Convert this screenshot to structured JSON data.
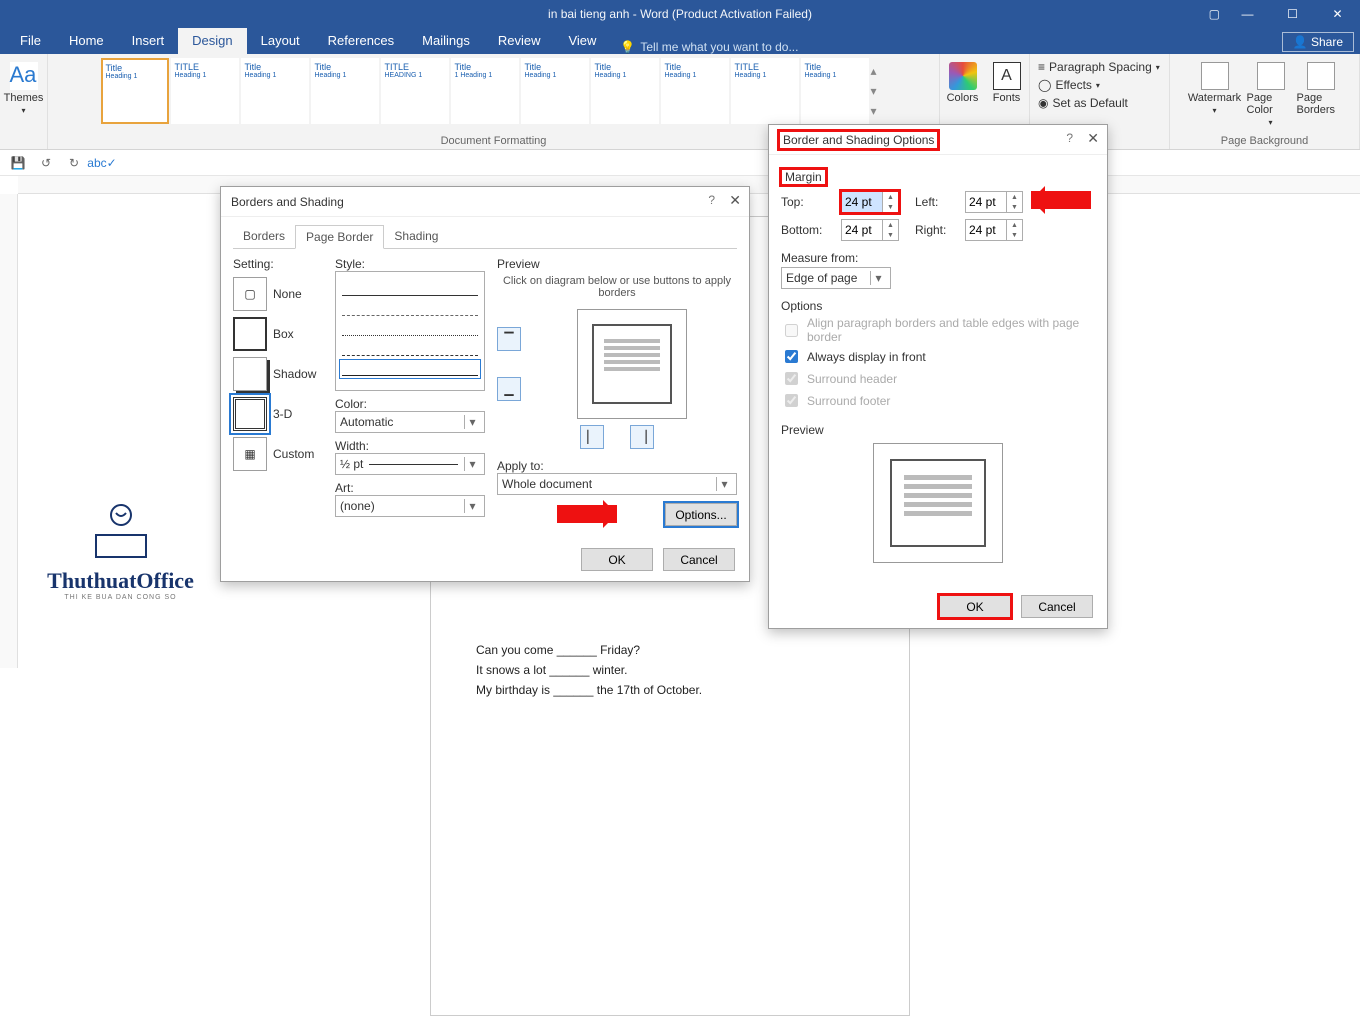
{
  "window": {
    "title": "in bai tieng anh - Word (Product Activation Failed)"
  },
  "ribbon": {
    "tabs": [
      "File",
      "Home",
      "Insert",
      "Design",
      "Layout",
      "References",
      "Mailings",
      "Review",
      "View"
    ],
    "active_tab": "Design",
    "tell_me": "Tell me what you want to do...",
    "share": "Share",
    "doc_formatting_label": "Document Formatting",
    "themes_label": "Themes",
    "colors_label": "Colors",
    "fonts_label": "Fonts",
    "paragraph_spacing": "Paragraph Spacing",
    "effects": "Effects",
    "set_as_default": "Set as Default",
    "page_background_label": "Page Background",
    "watermark": "Watermark",
    "page_color": "Page Color",
    "page_borders": "Page Borders",
    "gallery": [
      "Title",
      "TITLE",
      "Title",
      "Title",
      "TITLE",
      "Title",
      "Title",
      "Title",
      "Title",
      "TITLE",
      "Title"
    ]
  },
  "document": {
    "line1": "Can you come ______ Friday?",
    "line2": "It snows a lot ______ winter.",
    "line3": "My birthday is ______ the 17th of October."
  },
  "dlg_bs": {
    "title": "Borders and Shading",
    "tabs": [
      "Borders",
      "Page Border",
      "Shading"
    ],
    "active_tab": "Page Border",
    "setting_label": "Setting:",
    "settings": {
      "none": "None",
      "box": "Box",
      "shadow": "Shadow",
      "threed": "3-D",
      "custom": "Custom"
    },
    "style_label": "Style:",
    "color_label": "Color:",
    "color_value": "Automatic",
    "width_label": "Width:",
    "width_value": "½ pt",
    "art_label": "Art:",
    "art_value": "(none)",
    "preview_label": "Preview",
    "preview_hint": "Click on diagram below or use buttons to apply borders",
    "apply_to_label": "Apply to:",
    "apply_to_value": "Whole document",
    "options": "Options...",
    "ok": "OK",
    "cancel": "Cancel"
  },
  "dlg_bso": {
    "title": "Border and Shading Options",
    "margin_label": "Margin",
    "top_label": "Top:",
    "bottom_label": "Bottom:",
    "left_label": "Left:",
    "right_label": "Right:",
    "top_value": "24 pt",
    "bottom_value": "24 pt",
    "left_value": "24 pt",
    "right_value": "24 pt",
    "measure_from_label": "Measure from:",
    "measure_from_value": "Edge of page",
    "options_label": "Options",
    "align_option": "Align paragraph borders and table edges with page border",
    "always_front": "Always display in front",
    "surround_header": "Surround header",
    "surround_footer": "Surround footer",
    "preview_label": "Preview",
    "ok": "OK",
    "cancel": "Cancel"
  },
  "watermark_brand": {
    "name": "ThuthuatOffice",
    "sub": "THI KE BUA DAN CONG SO"
  }
}
